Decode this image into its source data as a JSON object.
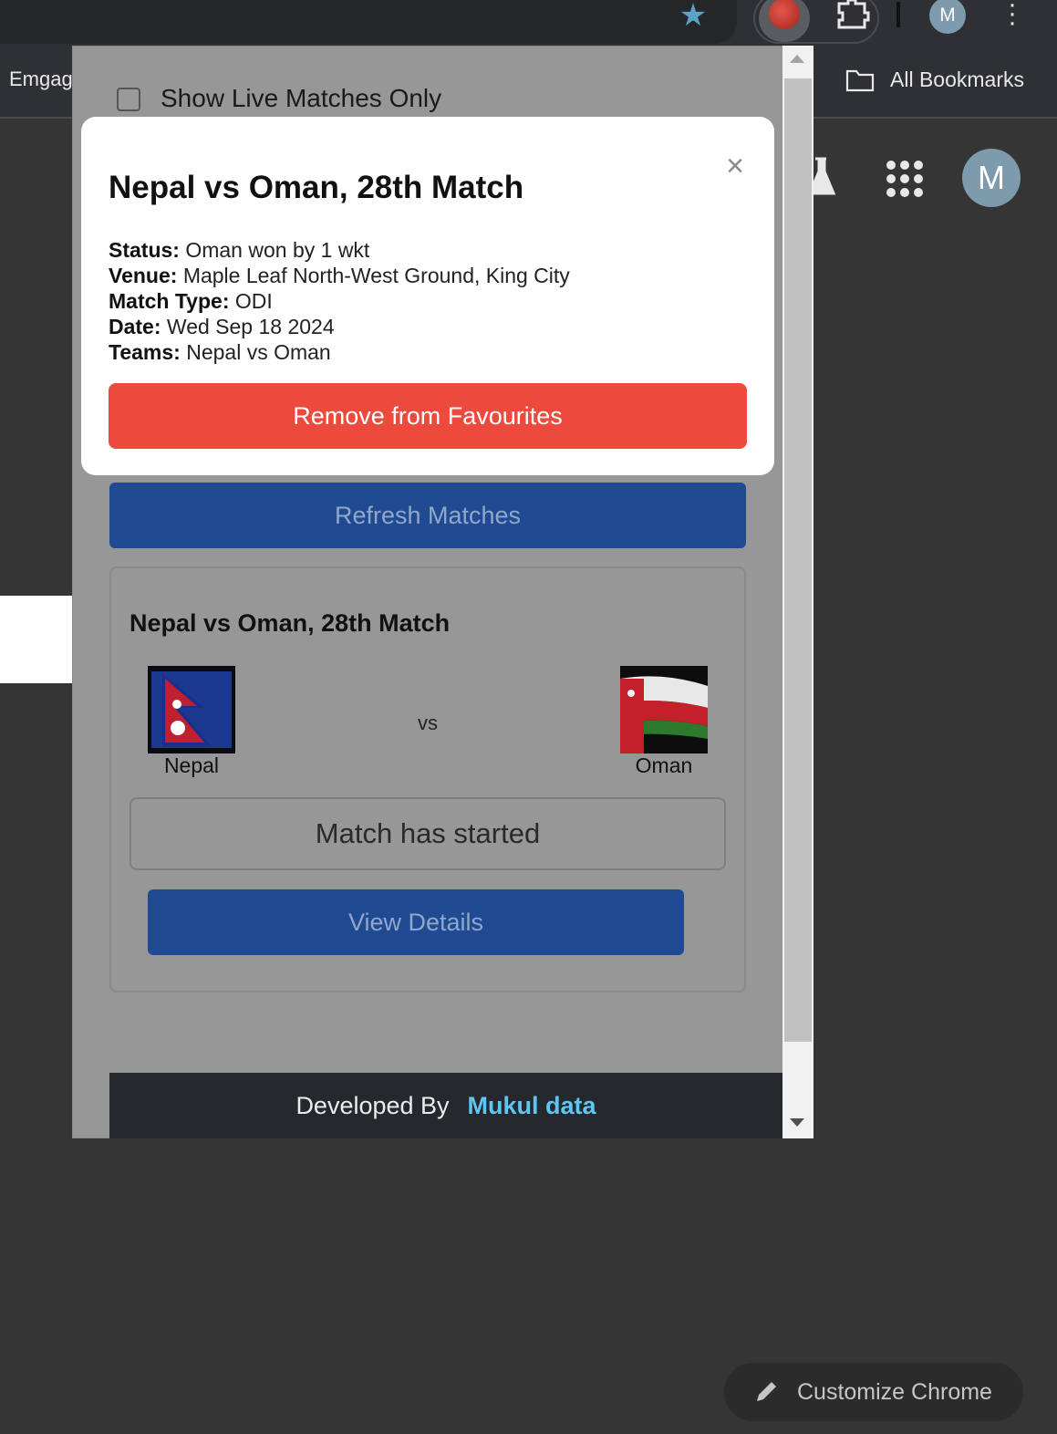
{
  "browser": {
    "bookmarks": [
      {
        "label": "Emgag"
      },
      {
        "label": "All Bookmarks"
      }
    ],
    "profile_initial": "M",
    "customize_label": "Customize Chrome"
  },
  "popup": {
    "live_filter_label": "Show Live Matches Only",
    "live_filter_checked": false,
    "modal": {
      "title": "Nepal vs Oman, 28th Match",
      "close_symbol": "×",
      "fields": [
        {
          "label": "Status:",
          "value": "Oman won by 1 wkt"
        },
        {
          "label": "Venue:",
          "value": "Maple Leaf North-West Ground, King City"
        },
        {
          "label": "Match Type:",
          "value": "ODI"
        },
        {
          "label": "Date:",
          "value": "Wed Sep 18 2024"
        },
        {
          "label": "Teams:",
          "value": "Nepal vs Oman"
        }
      ],
      "remove_label": "Remove from Favourites"
    },
    "refresh_label": "Refresh Matches",
    "match": {
      "title": "Nepal vs Oman, 28th Match",
      "team1": "Nepal",
      "team2": "Oman",
      "vs": "vs",
      "status": "Match has started",
      "details_label": "View Details"
    },
    "footer": {
      "prefix": "Developed By",
      "developer": "Mukul data"
    }
  },
  "colors": {
    "remove_button": "#eb4a3d",
    "primary_button": "#204a92",
    "developer_link": "#5fc6f3"
  }
}
